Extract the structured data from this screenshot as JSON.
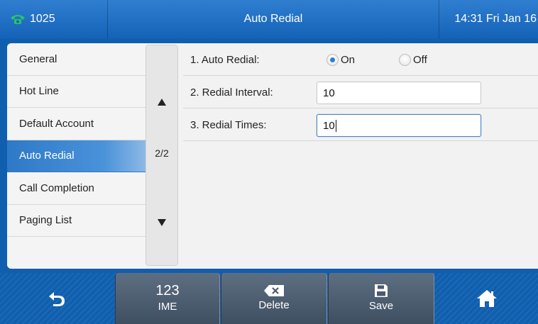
{
  "titlebar": {
    "account": "1025",
    "account_icon": "phone-handset-icon",
    "title": "Auto Redial",
    "clock": "14:31 Fri Jan 16"
  },
  "menu": {
    "items": [
      {
        "label": "General"
      },
      {
        "label": "Hot Line"
      },
      {
        "label": "Default Account"
      },
      {
        "label": "Auto Redial"
      },
      {
        "label": "Call Completion"
      },
      {
        "label": "Paging List"
      }
    ],
    "active": "Auto Redial"
  },
  "pager": {
    "page": "2/2",
    "up_icon": "arrow-up-icon",
    "down_icon": "arrow-down-icon"
  },
  "settings": {
    "auto_redial": {
      "label": "1. Auto Redial:",
      "options": [
        "On",
        "Off"
      ],
      "selected": "On"
    },
    "redial_interval": {
      "label": "2. Redial Interval:",
      "value": "10"
    },
    "redial_times": {
      "label": "3. Redial Times:",
      "value": "10"
    }
  },
  "softkeys": {
    "back_icon": "back-arrow-icon",
    "ime": {
      "top": "123",
      "label": "IME"
    },
    "delete": {
      "label": "Delete",
      "icon": "backspace-icon"
    },
    "save": {
      "label": "Save",
      "icon": "floppy-disk-icon"
    },
    "home_icon": "home-icon"
  },
  "colors": {
    "accent": "#2f7ed0",
    "titlebar": "#1563b8",
    "softkey": "#4a5a6d",
    "phone_icon": "#29c46a"
  }
}
